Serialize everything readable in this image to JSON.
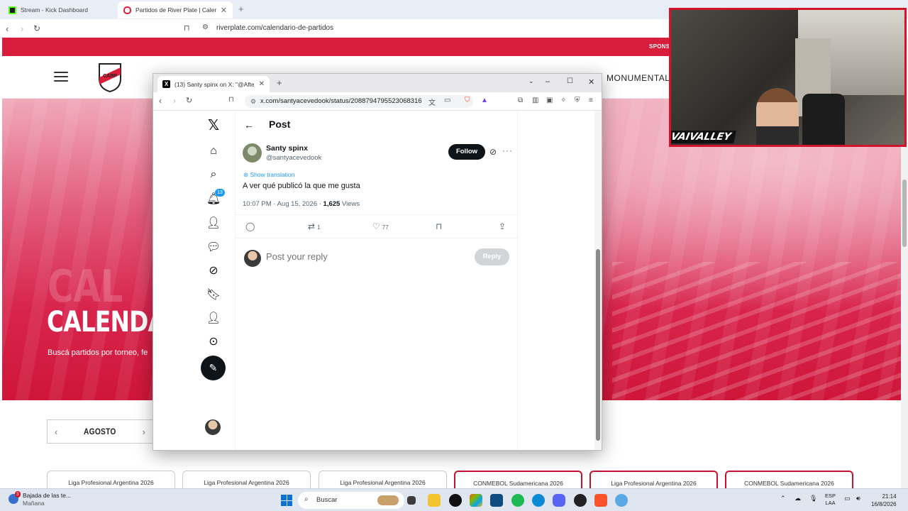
{
  "outer_browser": {
    "tabs": [
      {
        "label": "Stream - Kick Dashboard",
        "favicon_color": "#53fc18"
      },
      {
        "label": "Partidos de River Plate | Calenda",
        "favicon_color": "#d81e3a"
      }
    ],
    "url": "riverplate.com/calendario-de-partidos"
  },
  "river_site": {
    "topbar_text": "SPONS",
    "nav_item": "MONUMENTAL",
    "hero_title": "CALENDA",
    "hero_ghost": "CAL",
    "hero_subtitle": "Buscá partidos por torneo, fe",
    "month": "AGOSTO",
    "league_cards": [
      {
        "label": "Liga Profesional Argentina 2026"
      },
      {
        "label": "Liga Profesional Argentina 2026"
      },
      {
        "label": "Liga Profesional Argentina 2026"
      },
      {
        "label": "CONMEBOL Sudamericana 2026"
      },
      {
        "label": "Liga Profesional Argentina 2026"
      },
      {
        "label": "CONMEBOL Sudamericana 2026"
      }
    ],
    "brand_color": "#d81e3a"
  },
  "webcam": {
    "overlay_text": "VAIVALLEY"
  },
  "popup": {
    "tab_label": "(13) Santy spinx on X: \"@After_...",
    "url": "x.com/santyacevedook/status/2088794795523068316",
    "sidebar": {
      "notification_count": "13",
      "icons": [
        "x-logo-icon",
        "home-icon",
        "search-icon",
        "notifications-icon",
        "follow-icon",
        "messages-icon",
        "grok-icon",
        "bookmarks-icon",
        "profile-icon",
        "more-icon"
      ]
    },
    "post": {
      "heading": "Post",
      "author_name": "Santy spinx",
      "author_handle": "@santyacevedook",
      "follow_label": "Follow",
      "show_translation": "Show translation",
      "text": "A ver qué publicó la que me gusta",
      "timestamp": "10:07 PM · Aug 15, 2026 · ",
      "views_count": "1,625",
      "views_label": " Views",
      "reposts": "1",
      "likes": "77",
      "reply_placeholder": "Post your reply",
      "reply_button": "Reply"
    },
    "accent_color": "#1d9bf0"
  },
  "taskbar": {
    "weather_title": "Bajada de las te...",
    "weather_sub": "Mañana",
    "weather_badge": "3",
    "search_label": "Buscar",
    "lang_1": "ESP",
    "lang_2": "LAA",
    "time": "21:14",
    "date": "16/8/2026"
  }
}
